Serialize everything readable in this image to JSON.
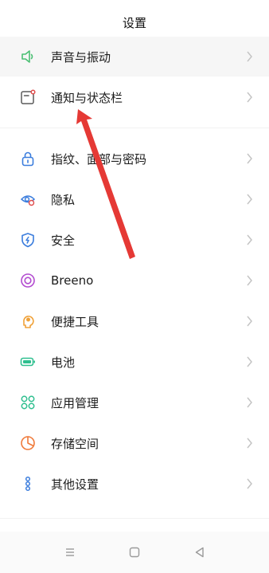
{
  "header": {
    "title": "设置"
  },
  "items": [
    {
      "label": "声音与振动",
      "icon": "speaker-icon",
      "color": "#4bbf73"
    },
    {
      "label": "通知与状态栏",
      "icon": "notification-icon",
      "color": "#e04b4b"
    },
    {
      "label": "指纹、面部与密码",
      "icon": "lock-icon",
      "color": "#3b7ddd"
    },
    {
      "label": "隐私",
      "icon": "privacy-eye-icon",
      "color": "#3b7ddd"
    },
    {
      "label": "安全",
      "icon": "shield-icon",
      "color": "#3b7ddd"
    },
    {
      "label": "Breeno",
      "icon": "breeno-icon",
      "color": "#b24bd0"
    },
    {
      "label": "便捷工具",
      "icon": "tools-icon",
      "color": "#f0a23a"
    },
    {
      "label": "电池",
      "icon": "battery-icon",
      "color": "#2fbf8f"
    },
    {
      "label": "应用管理",
      "icon": "apps-grid-icon",
      "color": "#2fbf8f"
    },
    {
      "label": "存储空间",
      "icon": "storage-pie-icon",
      "color": "#f07a3a"
    },
    {
      "label": "其他设置",
      "icon": "more-settings-icon",
      "color": "#3b7ddd"
    }
  ],
  "annotation": {
    "arrow_color": "#e53935"
  }
}
